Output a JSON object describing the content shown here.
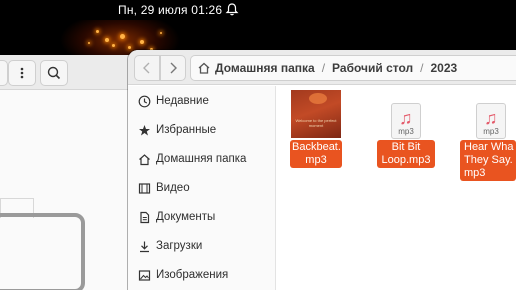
{
  "topbar": {
    "datetime": "Пн, 29 июля  01:26",
    "bell_icon": "alarm-bell-icon"
  },
  "back_window": {
    "menu_icon": "vertical-dots-icon",
    "search_icon": "search-icon"
  },
  "file_manager": {
    "nav": {
      "back_icon": "chevron-left-icon",
      "forward_icon": "chevron-right-icon"
    },
    "path": [
      "Домашняя папка",
      "Рабочий стол",
      "2023"
    ],
    "sidebar": [
      {
        "label": "Недавние",
        "icon": "clock-icon"
      },
      {
        "label": "Избранные",
        "icon": "star-icon"
      },
      {
        "label": "Домашняя папка",
        "icon": "home-icon"
      },
      {
        "label": "Видео",
        "icon": "film-icon"
      },
      {
        "label": "Документы",
        "icon": "document-icon"
      },
      {
        "label": "Загрузки",
        "icon": "download-icon"
      },
      {
        "label": "Изображения",
        "icon": "image-icon"
      }
    ],
    "files": [
      {
        "label": "Backbeat.\nmp3",
        "thumb_text": "Welcome to the perfect moment",
        "type": "album-art"
      },
      {
        "label": "Bit Bit\nLoop.mp3",
        "ext": "mp3",
        "type": "audio"
      },
      {
        "label": "Hear Wha\nThey Say.\nmp3",
        "ext": "mp3",
        "type": "audio"
      }
    ]
  },
  "colors": {
    "accent": "#e95420",
    "topbar": "#000000",
    "sidebar_bg": "#fafafa"
  }
}
